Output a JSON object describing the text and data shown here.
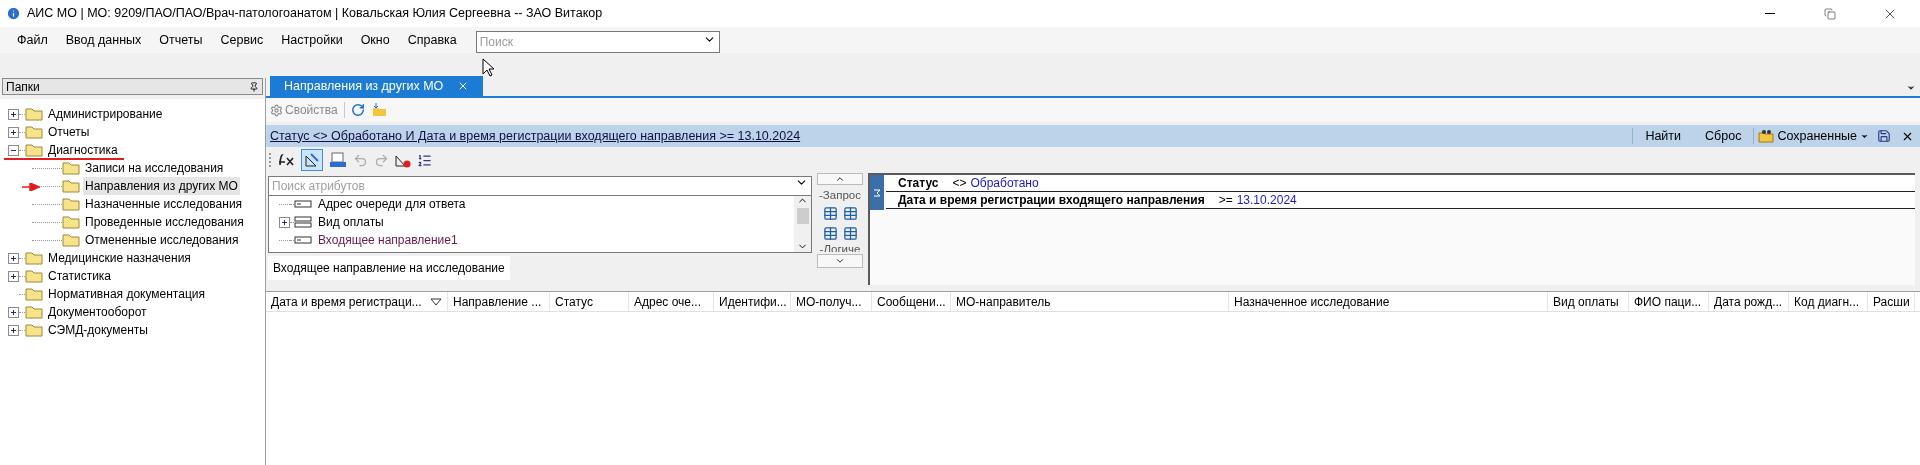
{
  "window": {
    "title": "АИС МО | МО: 9209/ПАО/ПАО/Врач-патологоанатом | Ковальская Юлия Сергеевна -- ЗАО Витакор"
  },
  "menu": [
    "Файл",
    "Ввод данных",
    "Отчеты",
    "Сервис",
    "Настройки",
    "Окно",
    "Справка"
  ],
  "search": {
    "placeholder": "Поиск"
  },
  "folders_panel": {
    "title": "Папки",
    "tree": [
      {
        "label": "Администрирование",
        "kind": "group",
        "expanded": false,
        "selected": false
      },
      {
        "label": "Отчеты",
        "kind": "group",
        "expanded": false,
        "selected": false
      },
      {
        "label": "Диагностика",
        "kind": "group",
        "expanded": true,
        "selected": false,
        "annotated": true,
        "children": [
          {
            "label": "Записи на исследования",
            "selected": false
          },
          {
            "label": "Направления из других МО",
            "selected": true
          },
          {
            "label": "Назначенные исследования",
            "selected": false
          },
          {
            "label": "Проведенные исследования",
            "selected": false
          },
          {
            "label": "Отмененные исследования",
            "selected": false
          }
        ]
      },
      {
        "label": "Медицинские назначения",
        "kind": "group",
        "expanded": false,
        "selected": false
      },
      {
        "label": "Статистика",
        "kind": "group",
        "expanded": false,
        "selected": false
      },
      {
        "label": "Нормативная документация",
        "kind": "item",
        "selected": false
      },
      {
        "label": "Документооборот",
        "kind": "group",
        "expanded": false,
        "selected": false
      },
      {
        "label": "СЭМД-документы",
        "kind": "group",
        "expanded": false,
        "selected": false
      }
    ]
  },
  "tabs": [
    {
      "label": "Направления из других МО",
      "selected": true
    }
  ],
  "toolbar": {
    "properties_button": "Свойства"
  },
  "filter_bar": {
    "query": "Статус <> Обработано И Дата и время регистрации входящего направления >= 13.10.2024",
    "buttons": [
      "Найти",
      "Сброс"
    ],
    "saved": "Сохраненные"
  },
  "attribute_search": {
    "placeholder": "Поиск атрибутов"
  },
  "attributes": [
    {
      "label": "Адрес очереди для ответа",
      "kind": "field"
    },
    {
      "label": "Вид оплаты",
      "kind": "group"
    },
    {
      "label": "Входящее направление1",
      "kind": "reference"
    }
  ],
  "entity_tab": "Входящее направление на исследование",
  "side_groups": [
    "-Запрос",
    "-Логиче"
  ],
  "conditions": [
    {
      "field": "Статус",
      "operator": "<>",
      "value": "Обработано"
    },
    {
      "field": "Дата и время регистрации входящего направления",
      "operator": ">=",
      "value": "13.10.2024"
    }
  ],
  "table": {
    "columns": [
      {
        "label": "Дата и время регистраци...",
        "sorted": true
      },
      {
        "label": "Направление ...",
        "sorted": false
      },
      {
        "label": "Статус",
        "sorted": false
      },
      {
        "label": "Адрес оче...",
        "sorted": false
      },
      {
        "label": "Идентифи...",
        "sorted": false
      },
      {
        "label": "МО-получ...",
        "sorted": false
      },
      {
        "label": "Сообщени...",
        "sorted": false
      },
      {
        "label": "МО-направитель",
        "sorted": false
      },
      {
        "label": "Назначенное исследование",
        "sorted": false
      },
      {
        "label": "Вид оплаты",
        "sorted": false
      },
      {
        "label": "ФИО паци...",
        "sorted": false
      },
      {
        "label": "Дата рожд...",
        "sorted": false
      },
      {
        "label": "Код диагн...",
        "sorted": false
      },
      {
        "label": "Расши",
        "sorted": false
      }
    ]
  }
}
